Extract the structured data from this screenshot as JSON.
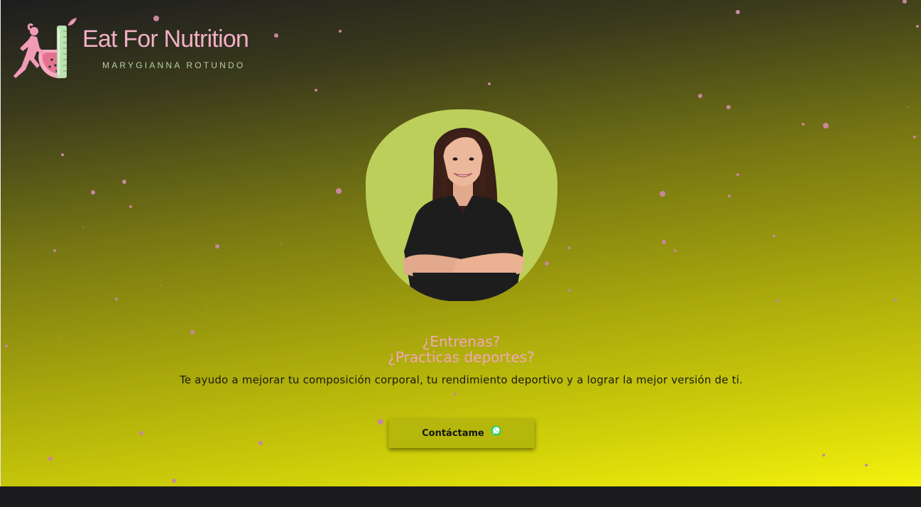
{
  "brand": {
    "title": "Eat For Nutrition",
    "subtitle": "MARYGIANNA ROTUNDO",
    "logo_icon": "runner-watermelon-logo-icon"
  },
  "hero": {
    "headline_line1": "¿Entrenas?",
    "headline_line2": "¿Practicas deportes?",
    "tagline": "Te ayudo a mejorar tu composición corporal, tu rendimiento deportivo y a lograr la mejor versión de ti.",
    "portrait_icon": "nutritionist-portrait"
  },
  "cta": {
    "label": "Contáctame",
    "icon": "whatsapp-icon"
  },
  "colors": {
    "accent_pink": "#f2a6bf",
    "button": "#b5b70c",
    "gradient_start": "#1d1d1f",
    "gradient_end": "#f4f20c",
    "portrait_bg": "#bccf5a"
  }
}
